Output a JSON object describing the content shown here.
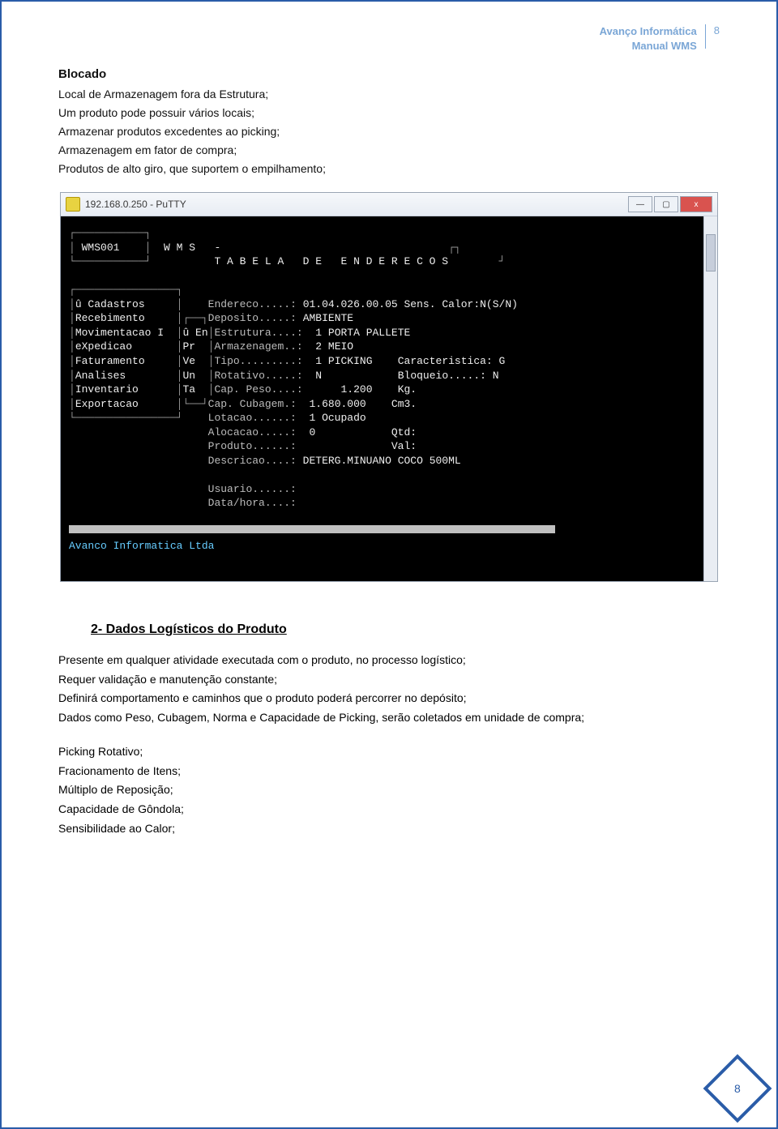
{
  "header": {
    "company": "Avanço Informática",
    "doc": "Manual WMS",
    "page": "8"
  },
  "section1": {
    "title": "Blocado",
    "lines": [
      "Local de Armazenagem fora da Estrutura;",
      "Um produto pode possuir vários locais;",
      "Armazenar produtos excedentes ao picking;",
      "Armazenagem em fator de compra;",
      "Produtos de alto giro, que suportem o empilhamento;"
    ]
  },
  "putty": {
    "title": "192.168.0.250 - PuTTY",
    "min": "—",
    "max": "▢",
    "close": "x",
    "top_left": "WMS001",
    "top_mid": "W M S   -",
    "screen_title": "T A B E L A   D E   E N D E R E C O S",
    "menu": [
      "û Cadastros",
      "Recebimento",
      "Movimentacao I",
      "eXpedicao",
      "Faturamento",
      "Analises",
      "Inventario",
      "Exportacao"
    ],
    "submenu": [
      "û En",
      "Pr",
      "Ve",
      "Un",
      "Ta"
    ],
    "fields": {
      "endereco": {
        "label": "Endereco.....:",
        "value": "01.04.026.00.05 Sens. Calor:N(S/N)"
      },
      "deposito": {
        "label": "Deposito.....:",
        "value": "AMBIENTE"
      },
      "estrutura": {
        "label": "Estrutura....:",
        "value": "1 PORTA PALLETE"
      },
      "armazenagem": {
        "label": "Armazenagem..:",
        "value": "2 MEIO"
      },
      "tipo": {
        "label": "Tipo.........:",
        "value": "1 PICKING    Caracteristica: G"
      },
      "rotativo": {
        "label": "Rotativo.....:",
        "value": "N            Bloqueio.....: N"
      },
      "cappeso": {
        "label": "Cap. Peso....:",
        "value": "    1.200    Kg."
      },
      "capcub": {
        "label": "Cap. Cubagem.:",
        "value": "1.680.000    Cm3."
      },
      "lotacao": {
        "label": "Lotacao......:",
        "value": "1 Ocupado"
      },
      "alocacao": {
        "label": "Alocacao.....:",
        "value": "0            Qtd:"
      },
      "produto": {
        "label": "Produto......:",
        "value": "             Val:"
      },
      "descricao": {
        "label": "Descricao....:",
        "value": "DETERG.MINUANO COCO 500ML"
      },
      "usuario": {
        "label": "Usuario......:",
        "value": ""
      },
      "datahora": {
        "label": "Data/hora....:",
        "value": ""
      }
    },
    "footer": "Avanco Informatica Ltda"
  },
  "section2": {
    "heading": "2-  Dados Logísticos do Produto",
    "paras": [
      "Presente em qualquer atividade executada com o produto, no processo logístico;",
      "Requer validação e manutenção constante;",
      "Definirá comportamento e caminhos que o produto poderá percorrer no depósito;",
      "Dados como Peso, Cubagem, Norma e Capacidade de Picking,  serão coletados em unidade de compra;"
    ],
    "list": [
      "Picking Rotativo;",
      "Fracionamento de Itens;",
      "Múltiplo de Reposição;",
      "Capacidade de Gôndola;",
      "Sensibilidade ao Calor;"
    ]
  },
  "footer_page": "8"
}
